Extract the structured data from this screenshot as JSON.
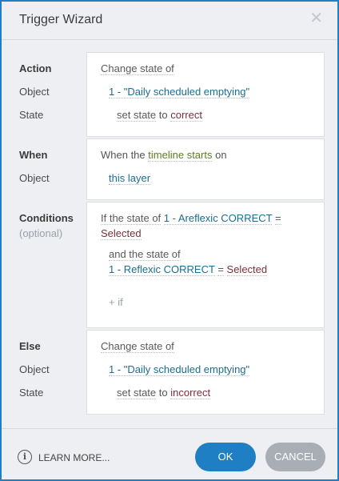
{
  "window": {
    "title": "Trigger Wizard",
    "close": "✕"
  },
  "action": {
    "labels": {
      "action": "Action",
      "object": "Object",
      "state": "State"
    },
    "verb": "Change state of",
    "object": "1 - \"Daily scheduled emptying\"",
    "state_prefix": "set state",
    "state_to": "to",
    "state_value": "correct"
  },
  "when": {
    "labels": {
      "when": "When",
      "object": "Object"
    },
    "prefix": "When the",
    "event": "timeline starts",
    "suffix": "on",
    "object": "this layer"
  },
  "conditions": {
    "labels": {
      "conditions": "Conditions",
      "optional": "(optional)"
    },
    "line1_prefix": "If the state of",
    "line1_object": "1 - Areflexic CORRECT",
    "line1_eq": "=",
    "line1_value": "Selected",
    "line2_prefix": "and the state of",
    "line2_object": "1 - Reflexic CORRECT",
    "line2_eq": "=",
    "line2_value": "Selected",
    "add": "+ if"
  },
  "else": {
    "labels": {
      "else": "Else",
      "object": "Object",
      "state": "State"
    },
    "verb": "Change state of",
    "object": "1 - \"Daily scheduled emptying\"",
    "state_prefix": "set state",
    "state_to": "to",
    "state_value": "incorrect"
  },
  "footer": {
    "info": "i",
    "learn_more": "LEARN MORE...",
    "ok": "OK",
    "cancel": "CANCEL"
  }
}
